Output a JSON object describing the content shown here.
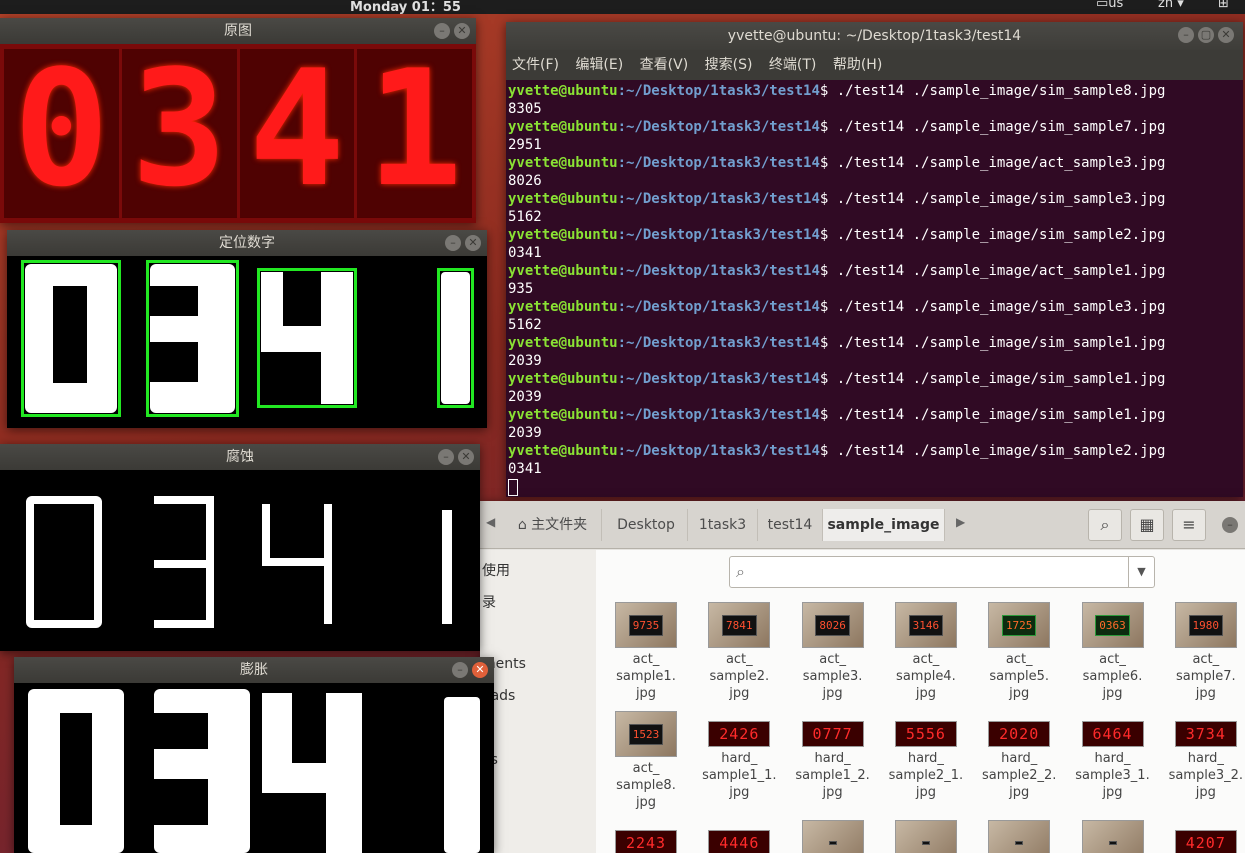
{
  "topbar": {
    "clock": "Monday 01：55",
    "keyboard": "us",
    "lang": "zh",
    "net_icon": "network-icon"
  },
  "orig": {
    "title": "原图",
    "digits": [
      "0",
      "3",
      "4",
      "1"
    ]
  },
  "locate": {
    "title": "定位数字",
    "digits": [
      "0",
      "3",
      "4",
      "1"
    ]
  },
  "erode": {
    "title": "腐蚀"
  },
  "dilate": {
    "title": "膨胀"
  },
  "terminal": {
    "title": "yvette@ubuntu: ~/Desktop/1task3/test14",
    "menu": [
      "文件(F)",
      "编辑(E)",
      "查看(V)",
      "搜索(S)",
      "终端(T)",
      "帮助(H)"
    ],
    "user": "yvette@ubuntu",
    "path": ":~/Desktop/1task3/test14",
    "lines": [
      {
        "cmd": "$ ./test14 ./sample_image/sim_sample8.jpg",
        "out": "8305"
      },
      {
        "cmd": "$ ./test14 ./sample_image/sim_sample7.jpg",
        "out": "2951"
      },
      {
        "cmd": "$ ./test14 ./sample_image/act_sample3.jpg",
        "out": "8026"
      },
      {
        "cmd": "$ ./test14 ./sample_image/sim_sample3.jpg",
        "out": "5162"
      },
      {
        "cmd": "$ ./test14 ./sample_image/sim_sample2.jpg",
        "out": "0341"
      },
      {
        "cmd": "$ ./test14 ./sample_image/act_sample1.jpg",
        "out": "935"
      },
      {
        "cmd": "$ ./test14 ./sample_image/sim_sample3.jpg",
        "out": "5162"
      },
      {
        "cmd": "$ ./test14 ./sample_image/sim_sample1.jpg",
        "out": "2039"
      },
      {
        "cmd": "$ ./test14 ./sample_image/sim_sample1.jpg",
        "out": "2039"
      },
      {
        "cmd": "$ ./test14 ./sample_image/sim_sample1.jpg",
        "out": "2039"
      },
      {
        "cmd": "$ ./test14 ./sample_image/sim_sample2.jpg",
        "out": "0341"
      }
    ]
  },
  "fm": {
    "crumbs": [
      "主文件夹",
      "Desktop",
      "1task3",
      "test14",
      "sample_image"
    ],
    "sidebar": [
      "使用",
      "录",
      "ments",
      "oads",
      "es",
      "s"
    ],
    "files": [
      {
        "l1": "act_",
        "l2": "sample1.",
        "l3": "jpg",
        "disp": "9735",
        "kind": "photo"
      },
      {
        "l1": "act_",
        "l2": "sample2.",
        "l3": "jpg",
        "disp": "7841",
        "kind": "photo"
      },
      {
        "l1": "act_",
        "l2": "sample3.",
        "l3": "jpg",
        "disp": "8026",
        "kind": "photo"
      },
      {
        "l1": "act_",
        "l2": "sample4.",
        "l3": "jpg",
        "disp": "3146",
        "kind": "photo"
      },
      {
        "l1": "act_",
        "l2": "sample5.",
        "l3": "jpg",
        "disp": "1725",
        "kind": "green"
      },
      {
        "l1": "act_",
        "l2": "sample6.",
        "l3": "jpg",
        "disp": "0363",
        "kind": "green"
      },
      {
        "l1": "act_",
        "l2": "sample7.",
        "l3": "jpg",
        "disp": "1980",
        "kind": "photo"
      },
      {
        "l1": "act_",
        "l2": "sample8.",
        "l3": "jpg",
        "disp": "1523",
        "kind": "photo"
      },
      {
        "l1": "hard_",
        "l2": "sample1_1.",
        "l3": "jpg",
        "disp": "2426",
        "kind": "hard"
      },
      {
        "l1": "hard_",
        "l2": "sample1_2.",
        "l3": "jpg",
        "disp": "0777",
        "kind": "hard"
      },
      {
        "l1": "hard_",
        "l2": "sample2_1.",
        "l3": "jpg",
        "disp": "5556",
        "kind": "hard"
      },
      {
        "l1": "hard_",
        "l2": "sample2_2.",
        "l3": "jpg",
        "disp": "2020",
        "kind": "hard"
      },
      {
        "l1": "hard_",
        "l2": "sample3_1.",
        "l3": "jpg",
        "disp": "6464",
        "kind": "hard"
      },
      {
        "l1": "hard_",
        "l2": "sample3_2.",
        "l3": "jpg",
        "disp": "3734",
        "kind": "hard"
      },
      {
        "l1": "",
        "l2": "",
        "l3": "",
        "disp": "2243",
        "kind": "hard"
      },
      {
        "l1": "",
        "l2": "",
        "l3": "",
        "disp": "4446",
        "kind": "hard"
      },
      {
        "l1": "",
        "l2": "",
        "l3": "",
        "disp": "",
        "kind": "photo"
      },
      {
        "l1": "",
        "l2": "",
        "l3": "",
        "disp": "",
        "kind": "photo"
      },
      {
        "l1": "",
        "l2": "",
        "l3": "",
        "disp": "",
        "kind": "photo"
      },
      {
        "l1": "",
        "l2": "",
        "l3": "",
        "disp": "",
        "kind": "photo"
      },
      {
        "l1": "",
        "l2": "",
        "l3": "",
        "disp": "4207",
        "kind": "hard"
      }
    ]
  },
  "colors": {
    "term_bg": "#300a24",
    "prompt_user": "#8ae234",
    "prompt_path": "#729fcf",
    "bbox": "#22e822",
    "led": "#ff1a1a"
  }
}
